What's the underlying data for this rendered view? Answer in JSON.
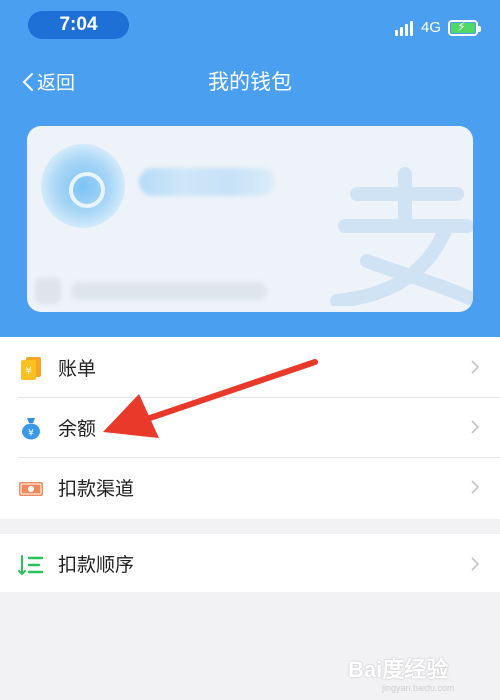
{
  "status_bar": {
    "time": "7:04",
    "network": "4G",
    "battery_level": 1.0,
    "icons": [
      "signal-icon",
      "battery-charging-icon"
    ]
  },
  "nav": {
    "back_label": "返回",
    "title": "我的钱包"
  },
  "card": {
    "logo_icon": "alipay-zhi-logo"
  },
  "menu": {
    "group_1": [
      {
        "label": "账单",
        "icon": "bill-icon"
      },
      {
        "label": "余额",
        "icon": "balance-bag-icon"
      },
      {
        "label": "扣款渠道",
        "icon": "payment-channel-icon"
      }
    ],
    "group_2": [
      {
        "label": "扣款顺序",
        "icon": "payment-order-icon"
      }
    ]
  },
  "watermark": {
    "brand": "Bai度经验",
    "url": "jingyan.baidu.com"
  },
  "colors": {
    "header_blue": "#4a9ff0",
    "time_pill": "#1e6fd6",
    "arrow_red": "#e8392b",
    "page_bg": "#f2f2f4"
  }
}
